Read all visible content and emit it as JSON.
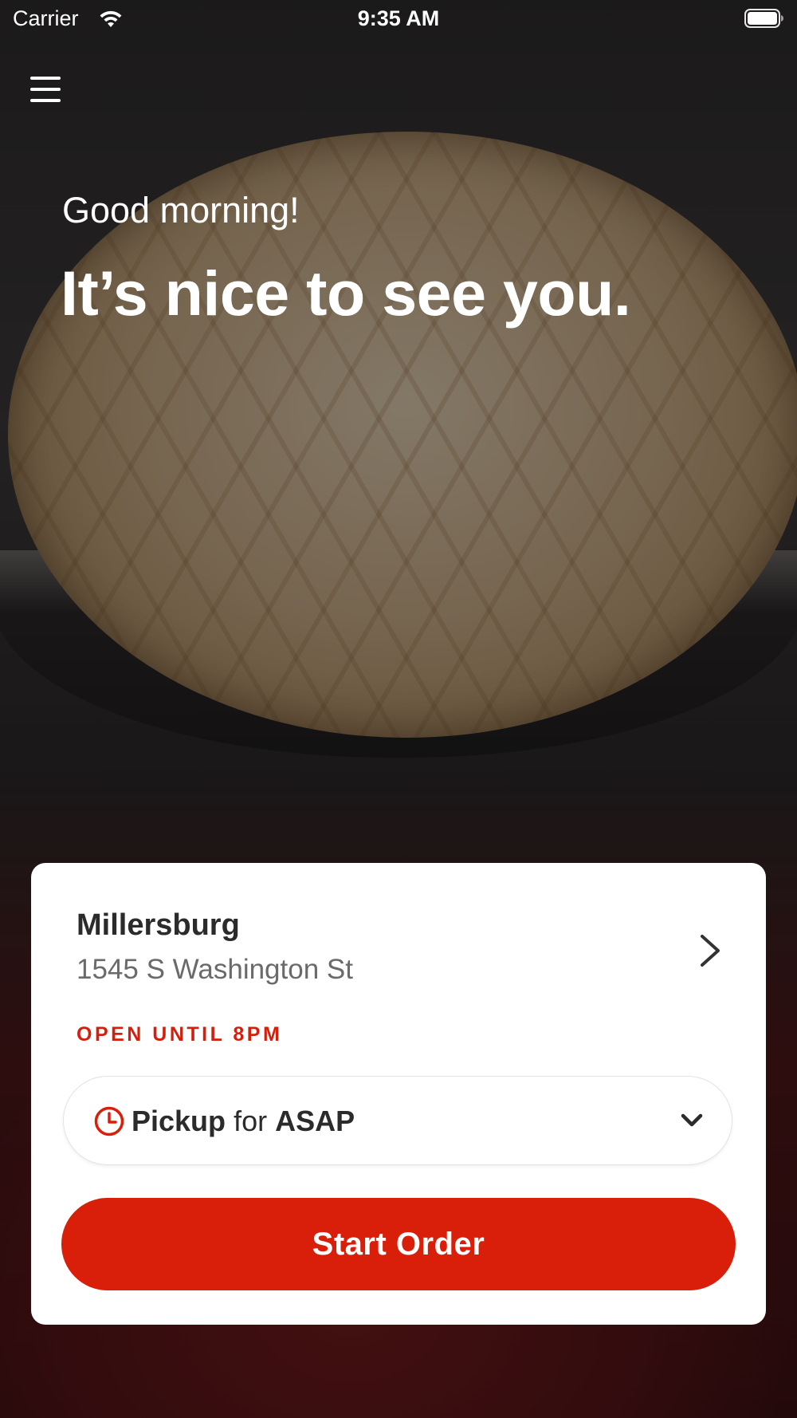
{
  "status_bar": {
    "carrier": "Carrier",
    "time": "9:35 AM"
  },
  "hero": {
    "greeting": "Good morning!",
    "headline": "It’s nice to see you."
  },
  "location": {
    "name": "Millersburg",
    "address": "1545 S Washington St",
    "hours_status": "OPEN UNTIL 8PM"
  },
  "order_time": {
    "method": "Pickup",
    "connector": "for",
    "time": "ASAP"
  },
  "actions": {
    "start_order_label": "Start Order"
  },
  "colors": {
    "accent": "#d91e0a",
    "status_text": "#d41f0d",
    "card_background": "#ffffff"
  },
  "icons": {
    "menu": "hamburger-menu-icon",
    "wifi": "wifi-icon",
    "battery": "battery-icon",
    "location_chevron": "chevron-right-icon",
    "time": "clock-icon",
    "dropdown": "chevron-down-icon"
  }
}
